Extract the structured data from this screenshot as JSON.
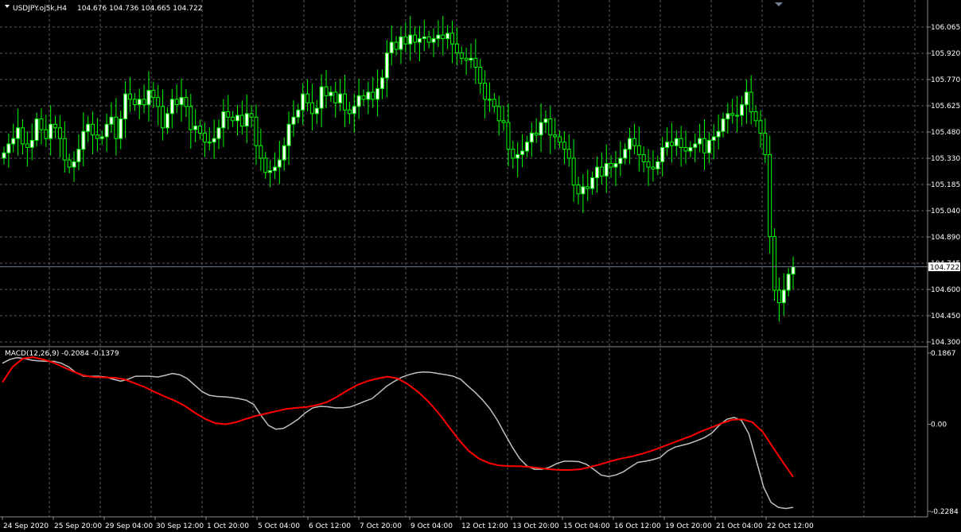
{
  "chart_header": {
    "symbol": "USDJPY.oj5k,H4",
    "ohlc": "104.676 104.736 104.665 104.722"
  },
  "macd_header": {
    "label": "MACD(12,26,9) -0.2084 -0.1379"
  },
  "price_axis": {
    "ticks": [
      "106.065",
      "105.920",
      "105.770",
      "105.625",
      "105.480",
      "105.330",
      "105.185",
      "105.040",
      "104.890",
      "104.745",
      "104.600",
      "104.450",
      "104.300"
    ],
    "current_price": "104.722"
  },
  "macd_axis": {
    "ticks": [
      "0.1867",
      "0.00",
      "-0.2284"
    ]
  },
  "time_axis": {
    "labels": [
      "24 Sep 2020",
      "25 Sep 20:00",
      "29 Sep 04:00",
      "30 Sep 12:00",
      "1 Oct 20:00",
      "5 Oct 04:00",
      "6 Oct 12:00",
      "7 Oct 20:00",
      "9 Oct 04:00",
      "12 Oct 12:00",
      "13 Oct 20:00",
      "15 Oct 04:00",
      "16 Oct 12:00",
      "19 Oct 20:00",
      "21 Oct 04:00",
      "22 Oct 12:00"
    ]
  },
  "colors": {
    "background": "#000000",
    "grid": "#5a5a5a",
    "candle_bull": "#ffffff",
    "candle_bear": "#000000",
    "wick": "#00ff00",
    "macd_main": "#c0c0c0",
    "macd_signal": "#ff0000",
    "bid_line": "#708090"
  },
  "chart_data": [
    {
      "type": "candlestick",
      "title": "USDJPY.oj5k,H4",
      "ylim": [
        104.3,
        106.1
      ],
      "closes": [
        105.36,
        105.41,
        105.44,
        105.5,
        105.41,
        105.39,
        105.43,
        105.55,
        105.49,
        105.44,
        105.52,
        105.5,
        105.44,
        105.32,
        105.28,
        105.31,
        105.38,
        105.48,
        105.52,
        105.46,
        105.44,
        105.45,
        105.52,
        105.56,
        105.44,
        105.55,
        105.69,
        105.66,
        105.63,
        105.66,
        105.63,
        105.71,
        105.67,
        105.62,
        105.5,
        105.58,
        105.66,
        105.63,
        105.67,
        105.62,
        105.49,
        105.51,
        105.47,
        105.42,
        105.42,
        105.44,
        105.5,
        105.59,
        105.56,
        105.54,
        105.57,
        105.51,
        105.58,
        105.56,
        105.4,
        105.33,
        105.25,
        105.26,
        105.28,
        105.32,
        105.4,
        105.52,
        105.56,
        105.6,
        105.69,
        105.64,
        105.58,
        105.61,
        105.73,
        105.68,
        105.7,
        105.64,
        105.69,
        105.6,
        105.58,
        105.62,
        105.68,
        105.66,
        105.7,
        105.66,
        105.72,
        105.78,
        105.92,
        105.98,
        105.94,
        106.01,
        105.97,
        106.02,
        105.98,
        106.0,
        106.01,
        105.98,
        106.0,
        106.02,
        106.0,
        106.03,
        105.97,
        105.92,
        105.89,
        105.88,
        105.89,
        105.84,
        105.75,
        105.66,
        105.66,
        105.62,
        105.54,
        105.53,
        105.38,
        105.33,
        105.35,
        105.37,
        105.42,
        105.47,
        105.46,
        105.53,
        105.55,
        105.46,
        105.45,
        105.42,
        105.38,
        105.33,
        105.18,
        105.13,
        105.17,
        105.16,
        105.22,
        105.28,
        105.23,
        105.3,
        105.28,
        105.3,
        105.33,
        105.38,
        105.44,
        105.4,
        105.35,
        105.31,
        105.28,
        105.27,
        105.31,
        105.39,
        105.42,
        105.4,
        105.44,
        105.39,
        105.37,
        105.39,
        105.41,
        105.44,
        105.36,
        105.43,
        105.45,
        105.48,
        105.55,
        105.58,
        105.57,
        105.57,
        105.63,
        105.7,
        105.59,
        105.54,
        105.47,
        105.35,
        104.89,
        104.59,
        104.52,
        104.59,
        104.68,
        104.72
      ]
    },
    {
      "type": "line",
      "title": "MACD(12,26,9)",
      "ylim": [
        -0.2284,
        0.1867
      ],
      "series": [
        {
          "name": "main",
          "values": [
            0.16,
            0.17,
            0.175,
            0.172,
            0.168,
            0.166,
            0.165,
            0.165,
            0.16,
            0.15,
            0.135,
            0.126,
            0.126,
            0.126,
            0.124,
            0.118,
            0.113,
            0.118,
            0.126,
            0.126,
            0.126,
            0.124,
            0.128,
            0.133,
            0.13,
            0.12,
            0.103,
            0.086,
            0.076,
            0.073,
            0.072,
            0.07,
            0.067,
            0.063,
            0.052,
            0.023,
            -0.003,
            -0.013,
            -0.011,
            0.0,
            0.013,
            0.03,
            0.043,
            0.047,
            0.046,
            0.043,
            0.043,
            0.045,
            0.052,
            0.06,
            0.067,
            0.083,
            0.1,
            0.112,
            0.123,
            0.13,
            0.135,
            0.137,
            0.136,
            0.133,
            0.13,
            0.126,
            0.118,
            0.1,
            0.083,
            0.063,
            0.04,
            0.01,
            -0.026,
            -0.06,
            -0.09,
            -0.11,
            -0.118,
            -0.118,
            -0.113,
            -0.103,
            -0.097,
            -0.097,
            -0.098,
            -0.105,
            -0.118,
            -0.133,
            -0.137,
            -0.133,
            -0.125,
            -0.112,
            -0.1,
            -0.097,
            -0.093,
            -0.087,
            -0.07,
            -0.06,
            -0.055,
            -0.05,
            -0.043,
            -0.035,
            -0.023,
            -0.003,
            0.013,
            0.018,
            0.01,
            -0.025,
            -0.095,
            -0.165,
            -0.205,
            -0.218,
            -0.221,
            -0.218
          ]
        },
        {
          "name": "signal",
          "values": [
            0.11,
            0.15,
            0.172,
            0.176,
            0.17,
            0.162,
            0.15,
            0.138,
            0.128,
            0.124,
            0.123,
            0.122,
            0.118,
            0.108,
            0.098,
            0.085,
            0.073,
            0.062,
            0.048,
            0.03,
            0.014,
            0.003,
            0.0,
            0.005,
            0.014,
            0.022,
            0.028,
            0.034,
            0.04,
            0.043,
            0.045,
            0.05,
            0.058,
            0.072,
            0.088,
            0.103,
            0.113,
            0.12,
            0.125,
            0.12,
            0.105,
            0.085,
            0.06,
            0.03,
            -0.005,
            -0.04,
            -0.07,
            -0.09,
            -0.102,
            -0.108,
            -0.11,
            -0.11,
            -0.112,
            -0.115,
            -0.118,
            -0.12,
            -0.12,
            -0.118,
            -0.112,
            -0.105,
            -0.097,
            -0.09,
            -0.085,
            -0.078,
            -0.07,
            -0.06,
            -0.05,
            -0.04,
            -0.03,
            -0.018,
            -0.008,
            0.003,
            0.012,
            0.013,
            0.005,
            -0.02,
            -0.06,
            -0.1,
            -0.138
          ]
        }
      ]
    }
  ]
}
